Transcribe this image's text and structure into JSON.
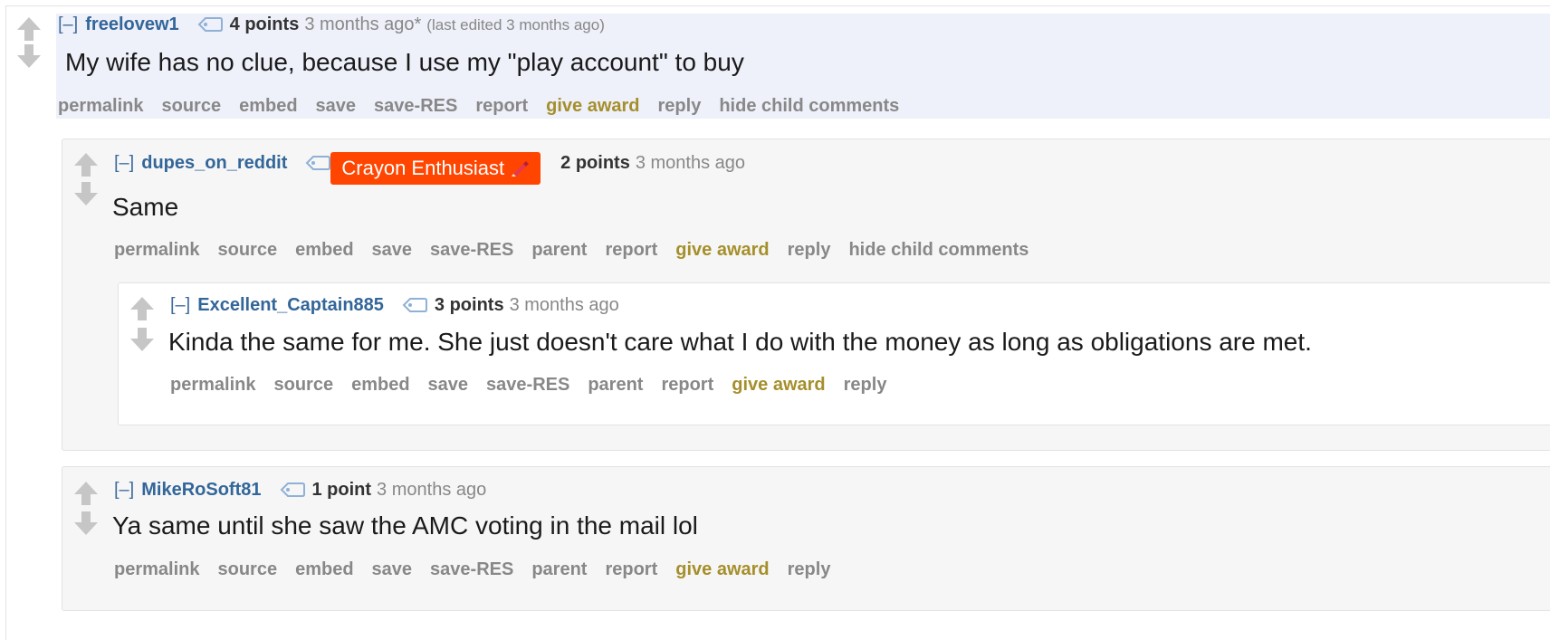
{
  "colors": {
    "author": "#336699",
    "award": "#a58f2b",
    "muted": "#888888",
    "flair_bg": "#ff4500"
  },
  "comments": [
    {
      "expand": "[–]",
      "author": "freelovew1",
      "score": "4 points",
      "time": "3 months ago*",
      "edited": "(last edited 3 months ago)",
      "body": "My wife has no clue, because I use my \"play account\" to buy",
      "buttons": {
        "permalink": "permalink",
        "source": "source",
        "embed": "embed",
        "save": "save",
        "save_res": "save-RES",
        "report": "report",
        "give_award": "give award",
        "reply": "reply",
        "hide": "hide child comments"
      }
    },
    {
      "expand": "[–]",
      "author": "dupes_on_reddit",
      "flair": "Crayon Enthusiast",
      "score": "2 points",
      "time": "3 months ago",
      "body": "Same",
      "buttons": {
        "permalink": "permalink",
        "source": "source",
        "embed": "embed",
        "save": "save",
        "save_res": "save-RES",
        "parent": "parent",
        "report": "report",
        "give_award": "give award",
        "reply": "reply",
        "hide": "hide child comments"
      }
    },
    {
      "expand": "[–]",
      "author": "Excellent_Captain885",
      "score": "3 points",
      "time": "3 months ago",
      "body": "Kinda the same for me. She just doesn't care what I do with the money as long as obligations are met.",
      "buttons": {
        "permalink": "permalink",
        "source": "source",
        "embed": "embed",
        "save": "save",
        "save_res": "save-RES",
        "parent": "parent",
        "report": "report",
        "give_award": "give award",
        "reply": "reply"
      }
    },
    {
      "expand": "[–]",
      "author": "MikeRoSoft81",
      "score": "1 point",
      "time": "3 months ago",
      "body": "Ya same until she saw the AMC voting in the mail lol",
      "buttons": {
        "permalink": "permalink",
        "source": "source",
        "embed": "embed",
        "save": "save",
        "save_res": "save-RES",
        "parent": "parent",
        "report": "report",
        "give_award": "give award",
        "reply": "reply"
      }
    }
  ]
}
